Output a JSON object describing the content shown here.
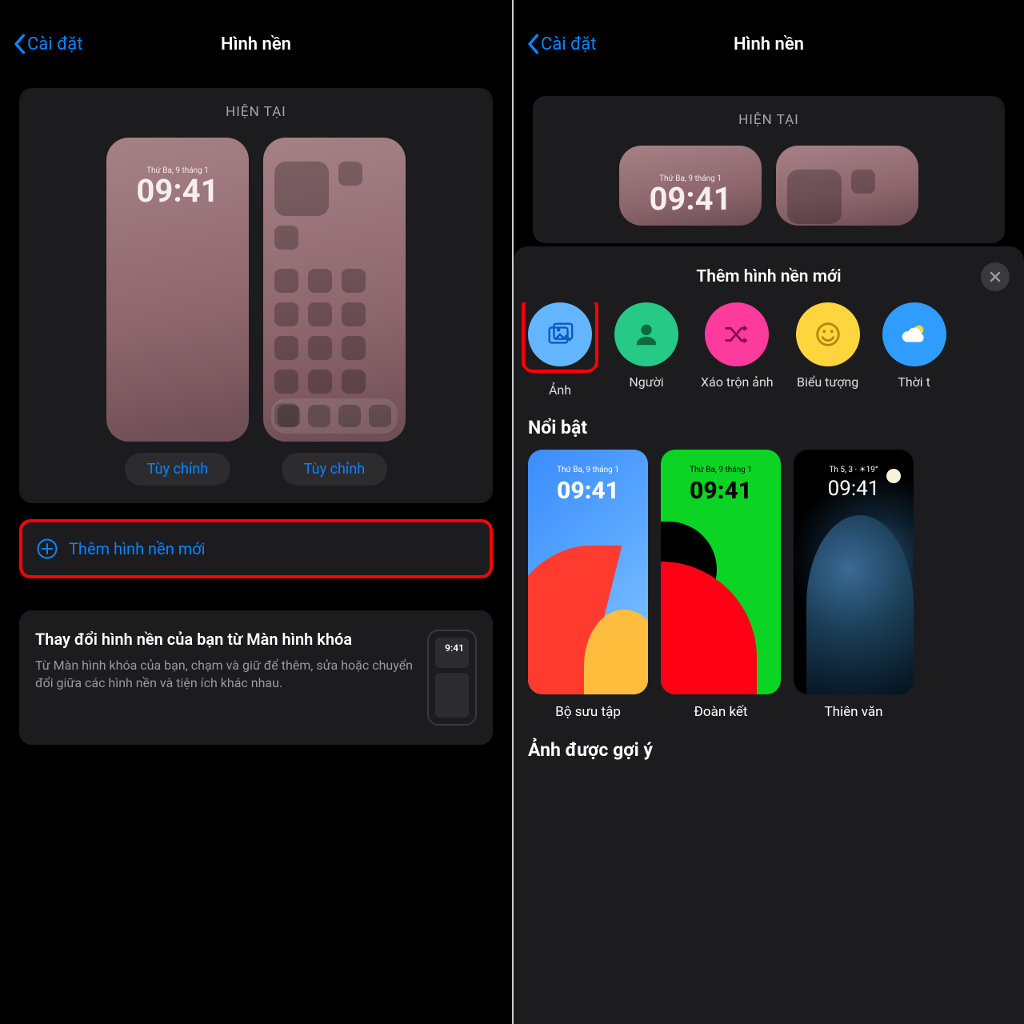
{
  "nav": {
    "back": "Cài đặt",
    "title": "Hình nền"
  },
  "current": {
    "header": "HIỆN TẠI",
    "lock_date": "Thứ Ba, 9 tháng 1",
    "lock_time": "09:41",
    "customize": "Tùy chỉnh"
  },
  "add_row": "Thêm hình nền mới",
  "tip": {
    "title": "Thay đổi hình nền của bạn từ Màn hình khóa",
    "body": "Từ Màn hình khóa của bạn, chạm và giữ để thêm, sửa hoặc chuyển đổi giữa các hình nền và tiện ích khác nhau.",
    "mini_time": "9:41"
  },
  "sheet": {
    "title": "Thêm hình nền mới",
    "categories": [
      {
        "key": "photos",
        "label": "Ảnh",
        "color": "#64b5ff",
        "icon": "photos"
      },
      {
        "key": "people",
        "label": "Người",
        "color": "#27c987",
        "icon": "person"
      },
      {
        "key": "shuffle",
        "label": "Xáo trộn ảnh",
        "color": "#ff3b9d",
        "icon": "shuffle"
      },
      {
        "key": "emoji",
        "label": "Biểu tượng",
        "color": "#ffd53e",
        "icon": "smile"
      },
      {
        "key": "weather",
        "label": "Thời t",
        "color": "#2f9dff",
        "icon": "cloud"
      }
    ],
    "featured": {
      "title": "Nổi bật",
      "items": [
        {
          "key": "collection",
          "label": "Bộ sưu tập",
          "date": "Thứ Ba, 9 tháng 1",
          "time": "09:41"
        },
        {
          "key": "unity",
          "label": "Đoàn kết",
          "date": "Thứ Ba, 9 tháng 1",
          "time": "09:41"
        },
        {
          "key": "astronomy",
          "label": "Thiên văn",
          "date": "Th 5, 3  ·  ☀︎19°",
          "time": "09:41"
        }
      ]
    },
    "suggested_title": "Ảnh được gợi ý"
  }
}
